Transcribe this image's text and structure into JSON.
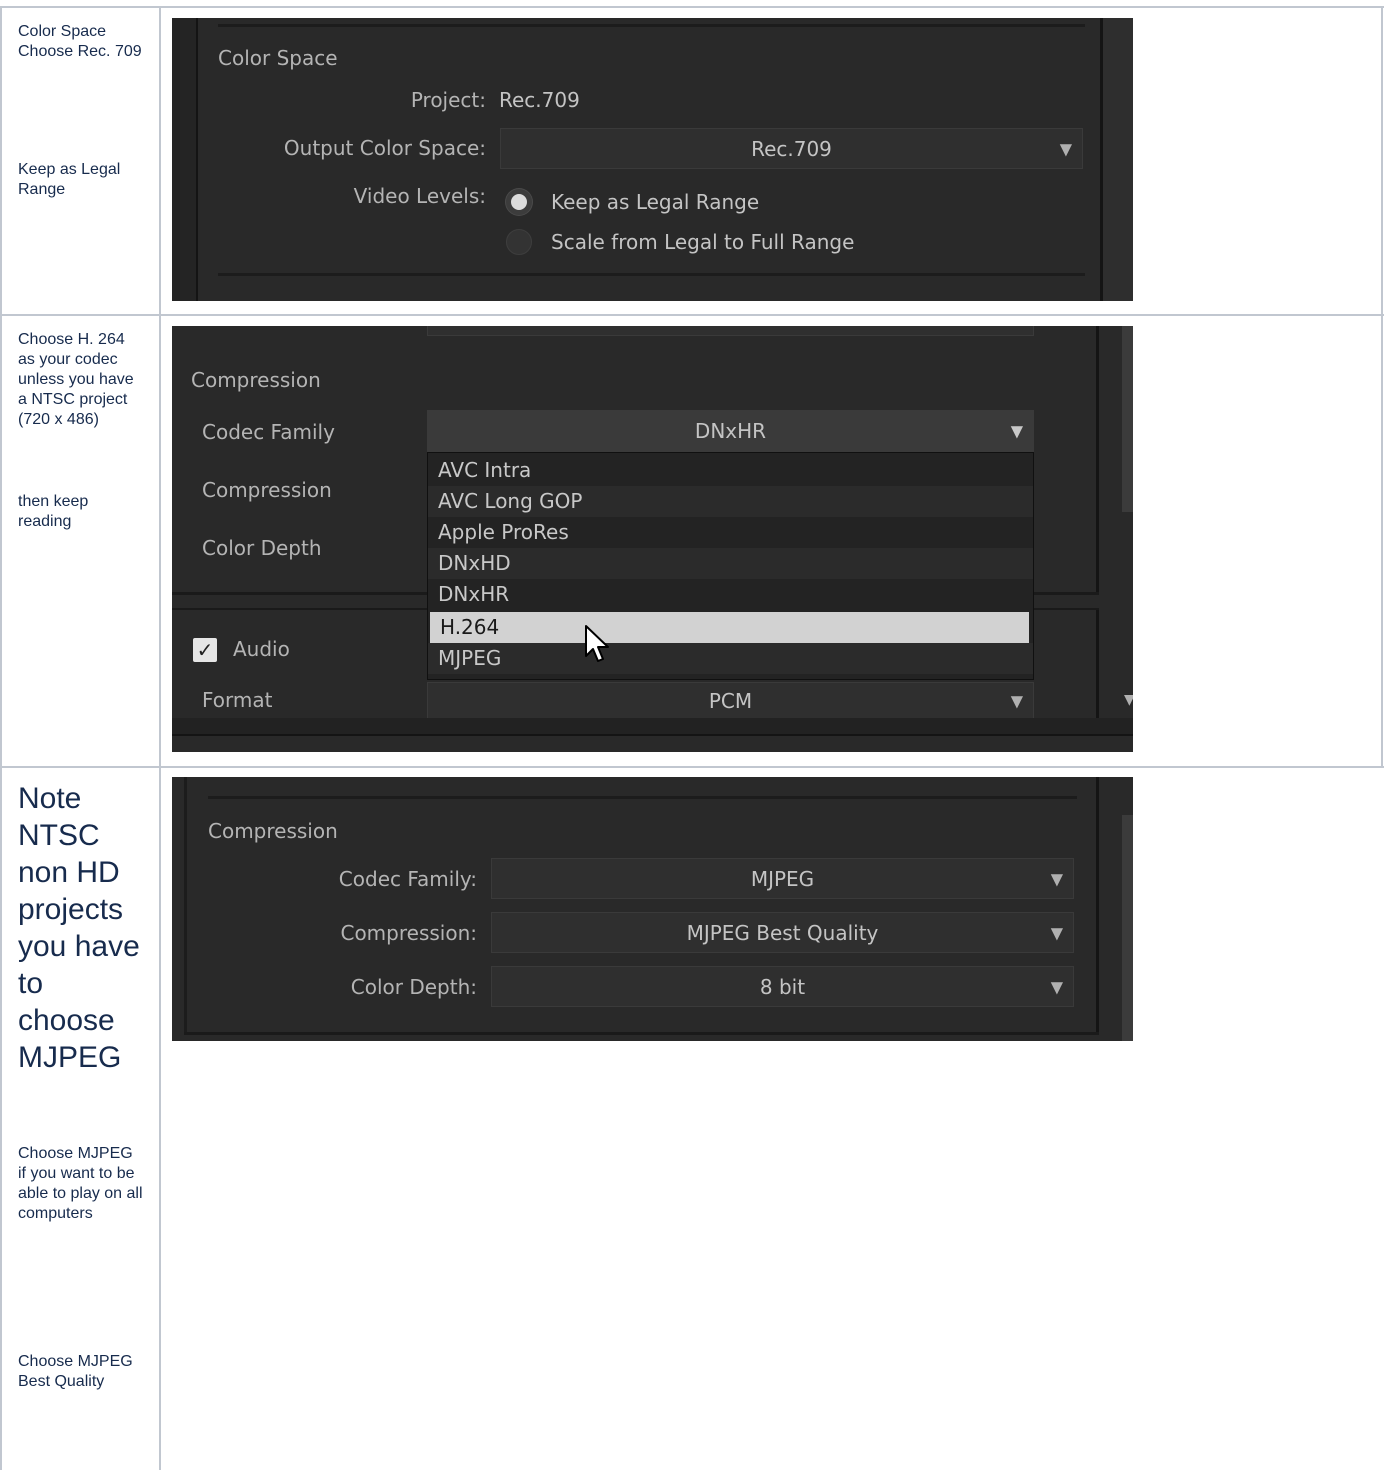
{
  "rows": [
    {
      "notes": [
        "Color Space Choose Rec. 709",
        "Keep as Legal Range"
      ],
      "screenshot": {
        "section_title": "Color Space",
        "project_label": "Project:",
        "project_value": "Rec.709",
        "output_label": "Output Color Space:",
        "output_value": "Rec.709",
        "levels_label": "Video Levels:",
        "levels_options": [
          "Keep as Legal Range",
          "Scale from Legal to Full Range"
        ],
        "levels_selected": "Keep as Legal Range"
      }
    },
    {
      "notes": [
        "Choose H. 264 as your codec unless you have a NTSC project (720 x 486)",
        "then keep reading"
      ],
      "screenshot": {
        "section_title": "Compression",
        "codec_family_label": "Codec Family",
        "codec_family_value": "DNxHR",
        "compression_label": "Compression",
        "color_depth_label": "Color Depth",
        "codec_options": [
          "AVC Intra",
          "AVC Long GOP",
          "Apple ProRes",
          "DNxHD",
          "DNxHR",
          "H.264",
          "MJPEG"
        ],
        "highlighted_option": "H.264",
        "audio_label": "Audio",
        "audio_checked": true,
        "format_label": "Format",
        "format_value": "PCM"
      }
    },
    {
      "notes": [
        "Note NTSC non HD projects you have to choose MJPEG",
        "Choose MJPEG if you want to be able to play on all computers",
        "Choose MJPEG Best Quality"
      ],
      "screenshot": {
        "section_title": "Compression",
        "codec_family_label": "Codec Family:",
        "codec_family_value": "MJPEG",
        "compression_label": "Compression:",
        "compression_value": "MJPEG Best Quality",
        "color_depth_label": "Color Depth:",
        "color_depth_value": "8 bit"
      }
    }
  ],
  "icons": [
    "dropdown-caret-icon",
    "mouse-cursor-icon",
    "checkmark-icon"
  ],
  "colors": {
    "panel_bg": "#292929",
    "field_bg": "#2f2f2f",
    "menu_highlight": "#d2d2d2",
    "table_border": "#c1c7d0"
  }
}
